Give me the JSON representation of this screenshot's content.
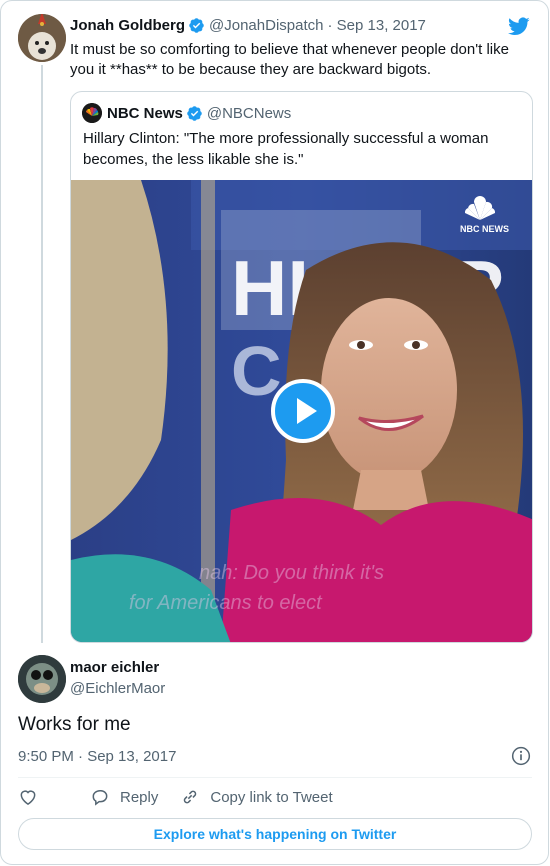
{
  "parent_tweet": {
    "author_name": "Jonah Goldberg",
    "handle": "@JonahDispatch",
    "date": "· Sep 13, 2017",
    "text": "It must be so comforting to believe that whenever people don't like you it **has** to be because they are backward bigots."
  },
  "quoted_tweet": {
    "author_name": "NBC News",
    "handle": "@NBCNews",
    "text": "Hillary Clinton: \"The more professionally successful a woman becomes, the less likable she is.\"",
    "video": {
      "logo_text": "NBC NEWS",
      "backdrop_text_top": "HI    AR",
      "backdrop_text_bottom": "C    O",
      "caption_line1": "nah: Do you think it's",
      "caption_line2": "for Americans to elect"
    }
  },
  "main_tweet": {
    "author_name": "maor eichler",
    "handle": "@EichlerMaor",
    "text": "Works for me",
    "timestamp": "9:50 PM · Sep 13, 2017"
  },
  "actions": {
    "reply_label": "Reply",
    "copy_link_label": "Copy link to Tweet"
  },
  "explore_label": "Explore what's happening on Twitter",
  "colors": {
    "accent": "#1d9bf0",
    "text": "#0f1419",
    "secondary_text": "#536471",
    "border": "#cfd9de"
  },
  "icons": [
    "verified-badge-icon",
    "twitter-bird-icon",
    "play-icon",
    "info-icon",
    "heart-icon",
    "reply-icon",
    "link-icon",
    "nbc-peacock-icon"
  ]
}
